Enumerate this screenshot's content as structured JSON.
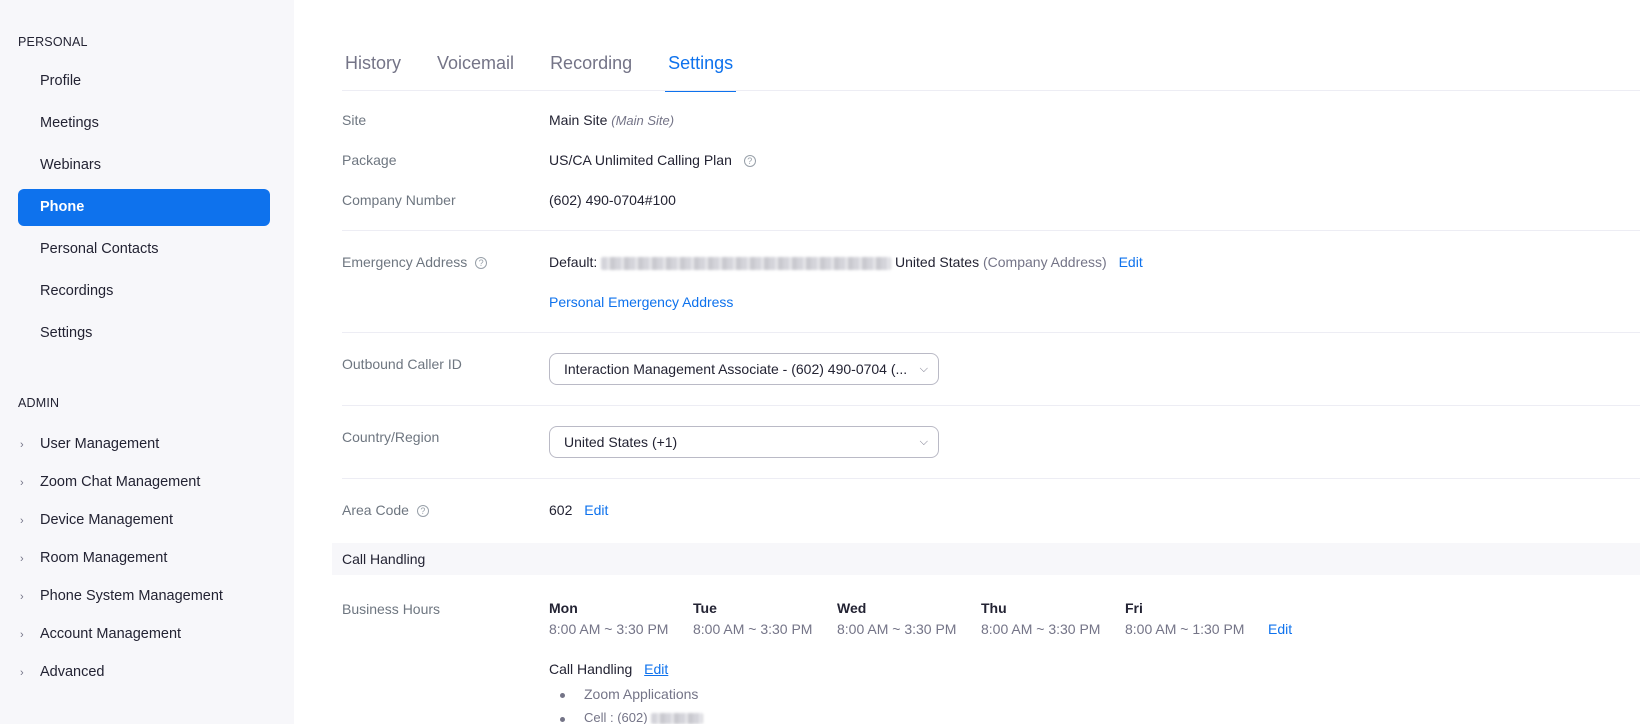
{
  "sidebar": {
    "personal_label": "PERSONAL",
    "personal_items": [
      {
        "label": "Profile"
      },
      {
        "label": "Meetings"
      },
      {
        "label": "Webinars"
      },
      {
        "label": "Phone",
        "active": true
      },
      {
        "label": "Personal Contacts"
      },
      {
        "label": "Recordings"
      },
      {
        "label": "Settings"
      }
    ],
    "admin_label": "ADMIN",
    "admin_items": [
      {
        "label": "User Management"
      },
      {
        "label": "Zoom Chat Management"
      },
      {
        "label": "Device Management"
      },
      {
        "label": "Room Management"
      },
      {
        "label": "Phone System Management"
      },
      {
        "label": "Account Management"
      },
      {
        "label": "Advanced"
      }
    ]
  },
  "tabs": [
    {
      "label": "History"
    },
    {
      "label": "Voicemail"
    },
    {
      "label": "Recording"
    },
    {
      "label": "Settings",
      "active": true
    }
  ],
  "settings": {
    "site_label": "Site",
    "site_value": "Main Site",
    "site_note": "(Main Site)",
    "package_label": "Package",
    "package_value": "US/CA Unlimited Calling Plan",
    "company_number_label": "Company Number",
    "company_number_value": "(602) 490-0704#100",
    "emergency_label": "Emergency Address",
    "emergency_prefix": "Default:",
    "emergency_country": "United States",
    "emergency_note": "(Company Address)",
    "emergency_edit": "Edit",
    "personal_emergency_link": "Personal Emergency Address",
    "caller_id_label": "Outbound Caller ID",
    "caller_id_value": "Interaction Management Associate - (602) 490-0704 (...",
    "country_label": "Country/Region",
    "country_value": "United States (+1)",
    "area_code_label": "Area Code",
    "area_code_value": "602",
    "area_code_edit": "Edit"
  },
  "call_handling": {
    "section_title": "Call Handling",
    "business_hours_label": "Business Hours",
    "days": [
      {
        "day": "Mon",
        "hours": "8:00 AM ~ 3:30 PM"
      },
      {
        "day": "Tue",
        "hours": "8:00 AM ~ 3:30 PM"
      },
      {
        "day": "Wed",
        "hours": "8:00 AM ~ 3:30 PM"
      },
      {
        "day": "Thu",
        "hours": "8:00 AM ~ 3:30 PM"
      },
      {
        "day": "Fri",
        "hours": "8:00 AM ~ 1:30 PM"
      }
    ],
    "hours_edit": "Edit",
    "sub_title": "Call Handling",
    "sub_edit": "Edit",
    "targets": [
      {
        "label": "Zoom Applications"
      },
      {
        "label": "Cell : (602)"
      }
    ]
  },
  "colors": {
    "accent": "#0e72ed",
    "sidebar_bg": "#f7f7fa",
    "text": "#232333",
    "muted": "#747487"
  }
}
